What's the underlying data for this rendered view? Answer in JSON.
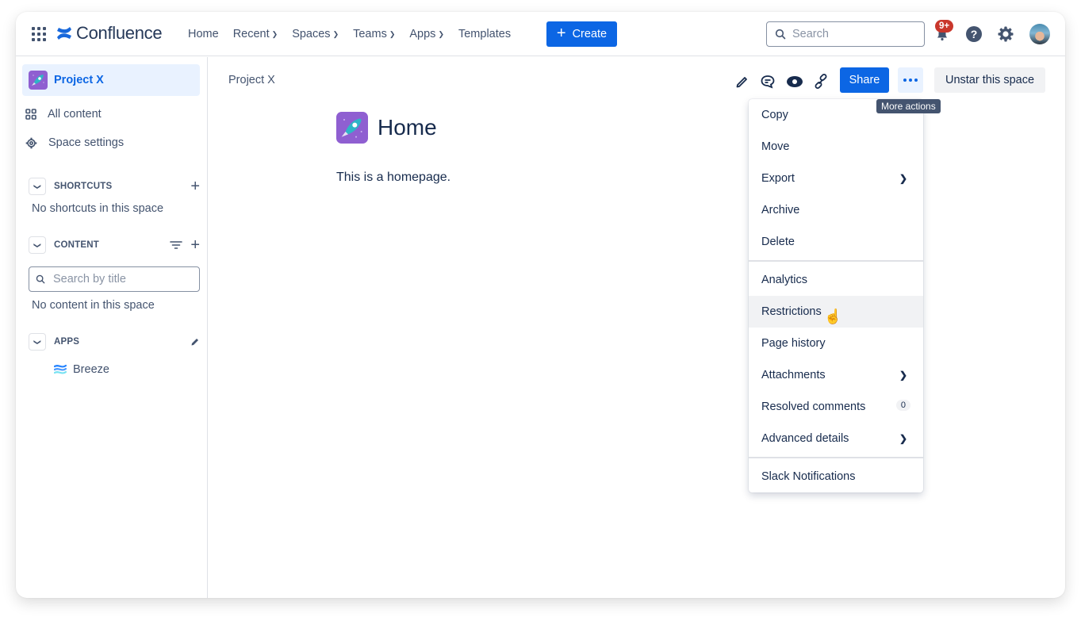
{
  "topnav": {
    "product_name": "Confluence",
    "items": [
      {
        "label": "Home",
        "has_dropdown": false
      },
      {
        "label": "Recent",
        "has_dropdown": true
      },
      {
        "label": "Spaces",
        "has_dropdown": true
      },
      {
        "label": "Teams",
        "has_dropdown": true
      },
      {
        "label": "Apps",
        "has_dropdown": true
      },
      {
        "label": "Templates",
        "has_dropdown": false
      }
    ],
    "create_label": "Create",
    "search_placeholder": "Search",
    "notification_badge": "9+",
    "icons": [
      "bell-icon",
      "help-icon",
      "settings-icon",
      "avatar"
    ]
  },
  "sidebar": {
    "space_name": "Project X",
    "links": [
      {
        "label": "All content",
        "icon": "grid-icon"
      },
      {
        "label": "Space settings",
        "icon": "gear-icon"
      }
    ],
    "sections": {
      "shortcuts": {
        "title": "SHORTCUTS",
        "empty": "No shortcuts in this space"
      },
      "content": {
        "title": "CONTENT",
        "search_placeholder": "Search by title",
        "empty": "No content in this space"
      },
      "apps": {
        "title": "APPS",
        "items": [
          {
            "label": "Breeze"
          }
        ]
      }
    }
  },
  "main": {
    "breadcrumb": "Project X",
    "title": "Home",
    "body": "This is a homepage.",
    "toolbar": {
      "share_label": "Share",
      "unstar_label": "Unstar this space",
      "more_tooltip": "More actions"
    }
  },
  "more_menu": {
    "groups": [
      [
        {
          "label": "Copy"
        },
        {
          "label": "Move"
        },
        {
          "label": "Export",
          "submenu": true
        },
        {
          "label": "Archive"
        },
        {
          "label": "Delete"
        }
      ],
      [
        {
          "label": "Analytics"
        },
        {
          "label": "Restrictions",
          "hovered": true
        },
        {
          "label": "Page history"
        },
        {
          "label": "Attachments",
          "submenu": true
        },
        {
          "label": "Resolved comments",
          "count": "0"
        },
        {
          "label": "Advanced details",
          "submenu": true
        }
      ],
      [
        {
          "label": "Slack Notifications"
        }
      ]
    ]
  },
  "colors": {
    "brand_blue": "#0c66e4",
    "selected_bg": "#e9f2ff",
    "badge_red": "#c9372c",
    "text": "#172b4d"
  }
}
